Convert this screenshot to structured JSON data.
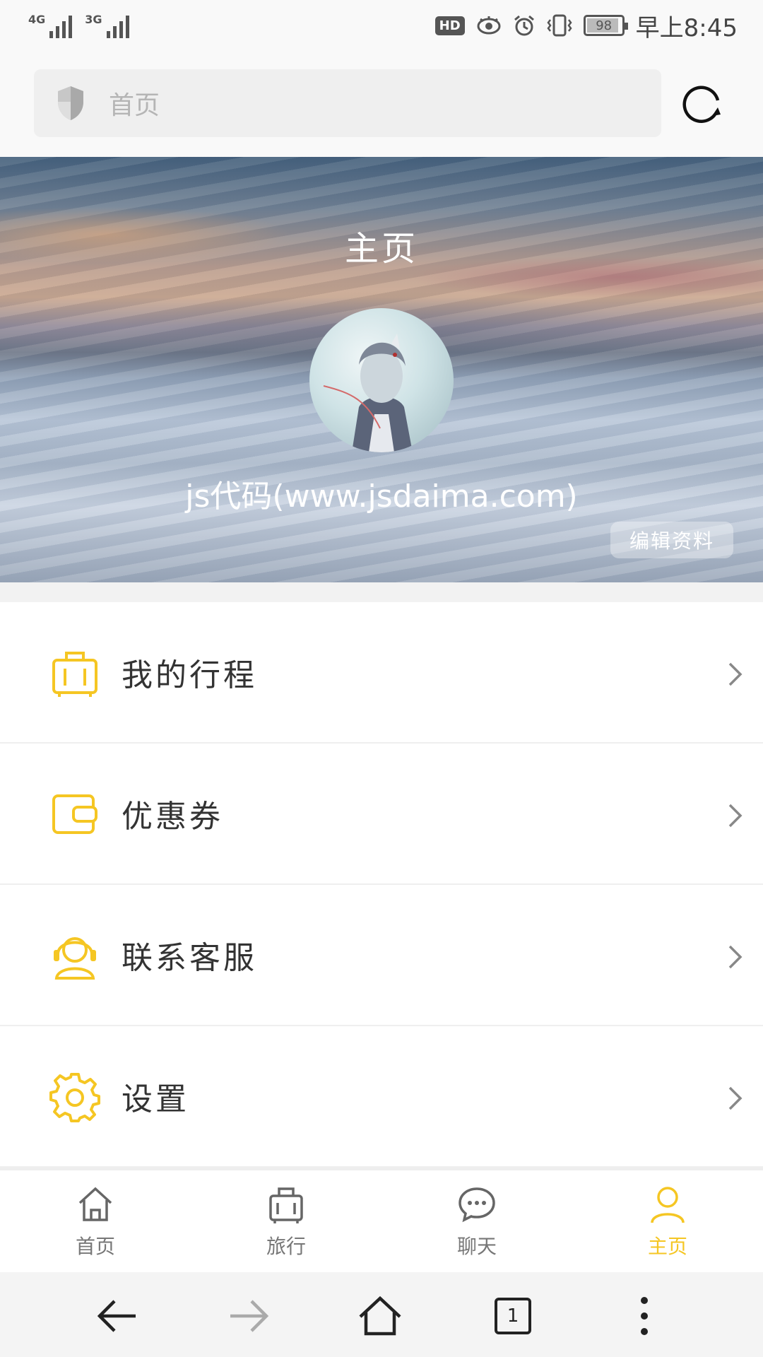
{
  "status_bar": {
    "network1": "4G",
    "network2": "3G",
    "hd": "HD",
    "battery": "98",
    "time": "早上8:45"
  },
  "address_bar": {
    "url_text": "首页",
    "icons": [
      "shield-icon",
      "reload-icon"
    ]
  },
  "hero": {
    "title": "主页",
    "username": "js代码(www.jsdaima.com)",
    "edit_button": "编辑资料"
  },
  "menu": [
    {
      "label": "我的行程",
      "icon": "luggage-icon"
    },
    {
      "label": "优惠券",
      "icon": "wallet-icon"
    },
    {
      "label": "联系客服",
      "icon": "customer-service-icon"
    },
    {
      "label": "设置",
      "icon": "gear-icon"
    }
  ],
  "tabbar": {
    "tabs": [
      {
        "label": "首页",
        "icon": "home-icon",
        "active": false
      },
      {
        "label": "旅行",
        "icon": "luggage-icon",
        "active": false
      },
      {
        "label": "聊天",
        "icon": "chat-icon",
        "active": false
      },
      {
        "label": "主页",
        "icon": "user-icon",
        "active": true
      }
    ]
  },
  "browser_nav": {
    "tab_count": "1"
  },
  "colors": {
    "accent": "#f5c623",
    "text": "#333333",
    "muted": "#777777"
  }
}
